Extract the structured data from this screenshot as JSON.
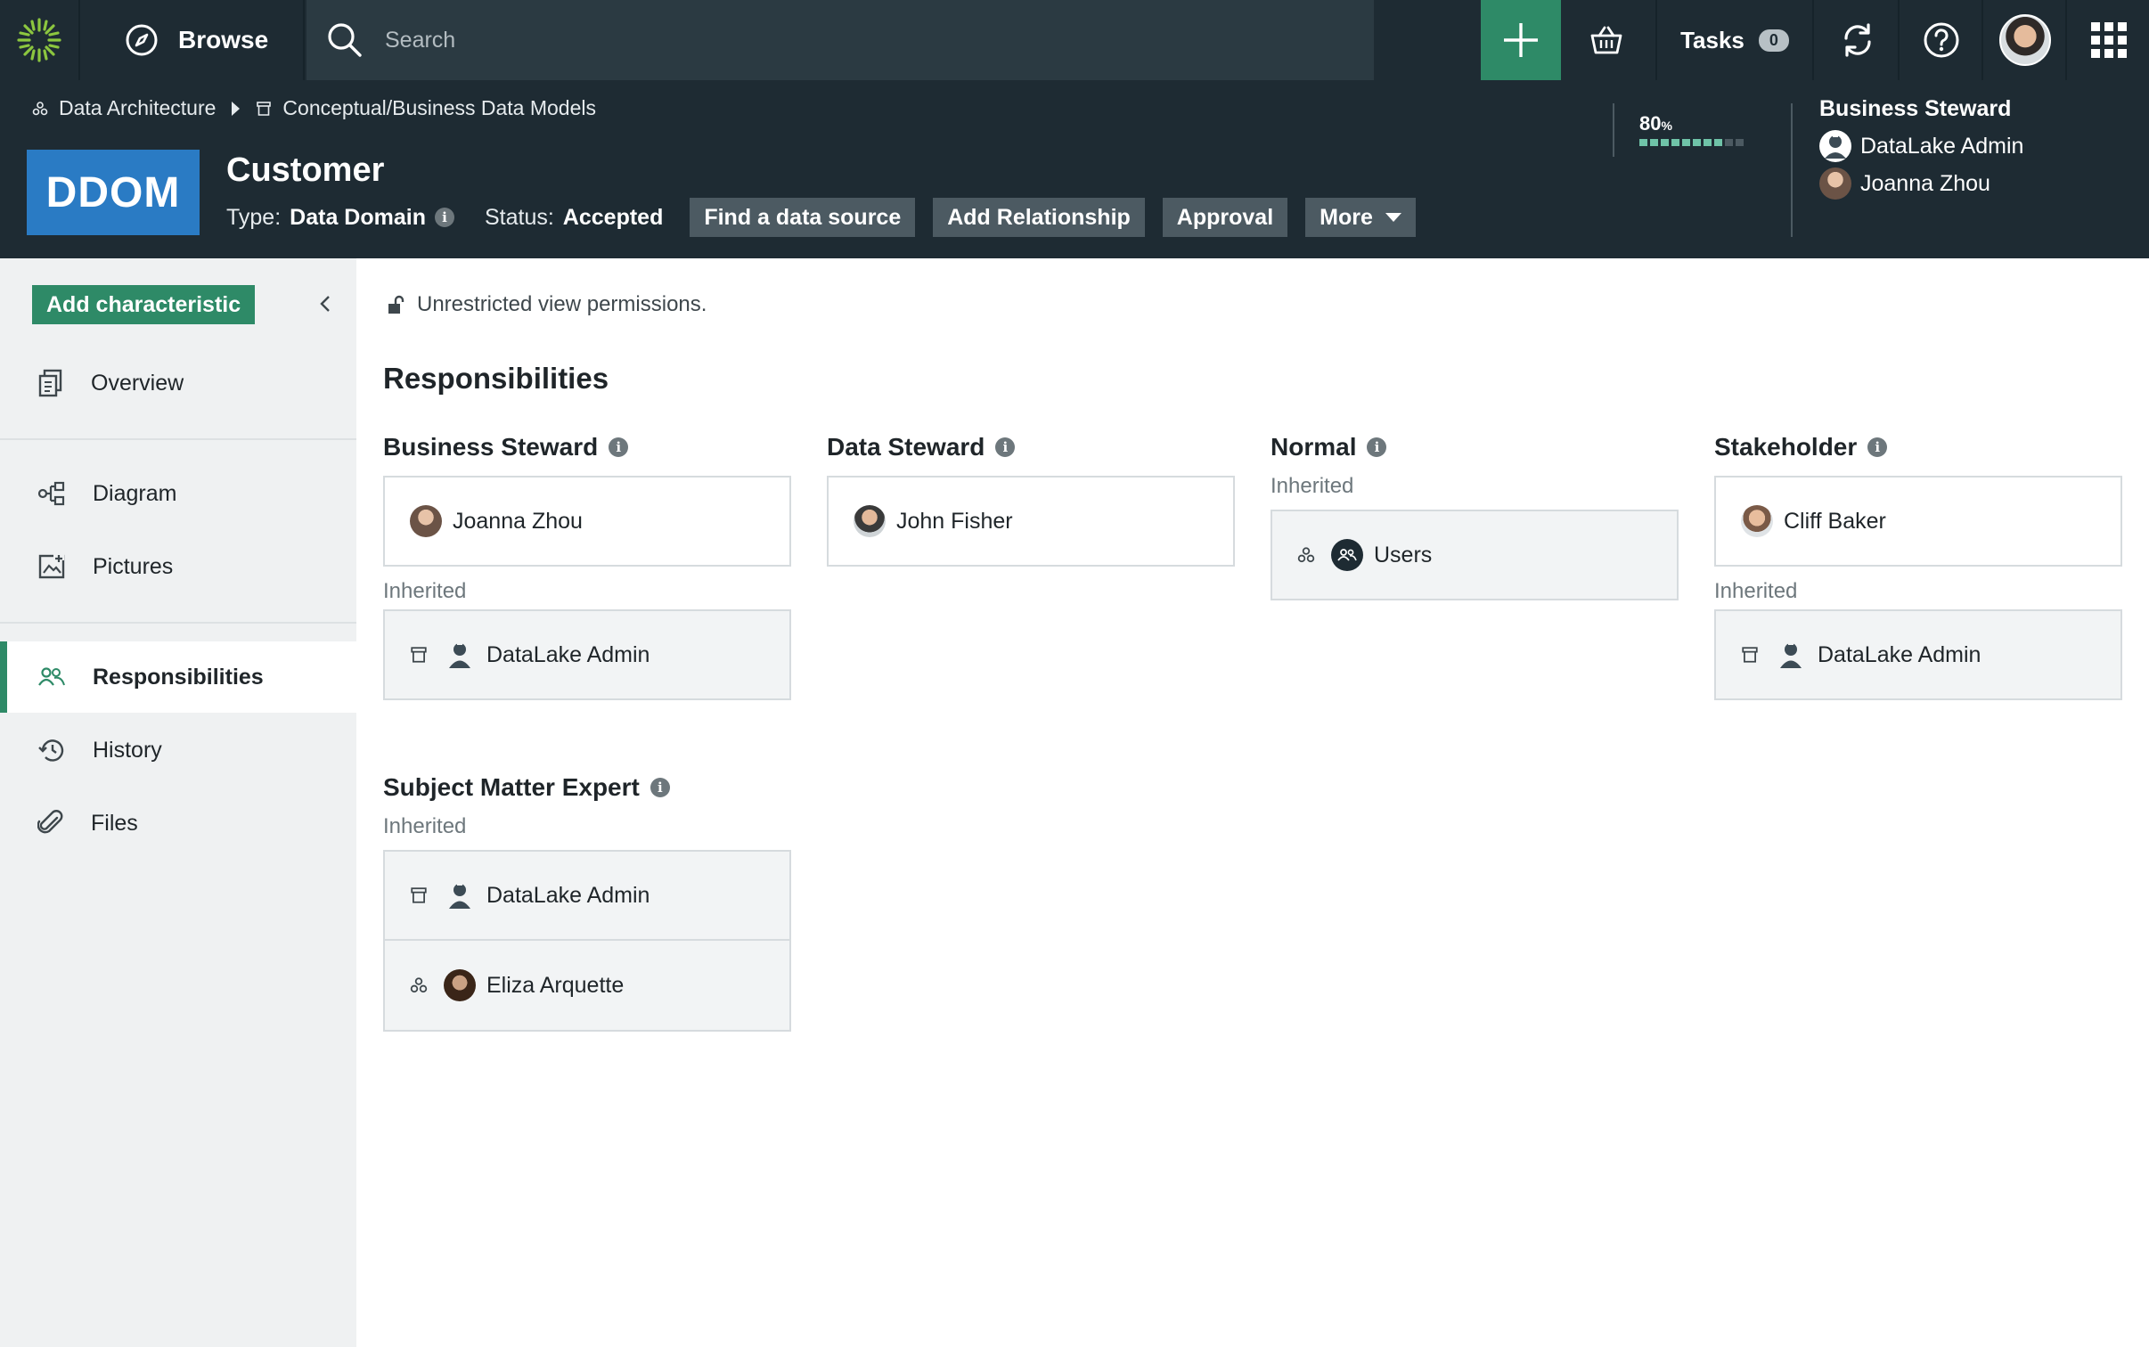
{
  "topbar": {
    "browse_label": "Browse",
    "search_placeholder": "Search",
    "tasks_label": "Tasks",
    "tasks_count": "0",
    "icons": [
      "logo-icon",
      "compass-icon",
      "search-icon",
      "plus-icon",
      "basket-icon",
      "sync-icon",
      "help-icon",
      "avatar",
      "apps-grid-icon"
    ],
    "accent_color": "#2e8a67"
  },
  "header": {
    "breadcrumb": [
      {
        "label": "Data Architecture",
        "icon": "community-icon"
      },
      {
        "label": "Conceptual/Business Data Models",
        "icon": "domain-icon"
      }
    ],
    "asset_badge": "DDOM",
    "asset_badge_color": "#2a7bc4",
    "title": "Customer",
    "type_label": "Type:",
    "type_value": "Data Domain",
    "status_label": "Status:",
    "status_value": "Accepted",
    "actions": [
      "Find a data source",
      "Add Relationship",
      "Approval",
      "More"
    ],
    "score_value": "80",
    "score_unit": "%",
    "score_fraction": 0.8,
    "steward_label": "Business Steward",
    "stewards": [
      "DataLake Admin",
      "Joanna Zhou"
    ]
  },
  "sidebar": {
    "add_button": "Add characteristic",
    "items": [
      {
        "label": "Overview",
        "icon": "overview-icon"
      },
      {
        "label": "Diagram",
        "icon": "diagram-icon"
      },
      {
        "label": "Pictures",
        "icon": "pictures-icon"
      },
      {
        "label": "Responsibilities",
        "icon": "users-icon",
        "active": true
      },
      {
        "label": "History",
        "icon": "history-icon"
      },
      {
        "label": "Files",
        "icon": "paperclip-icon"
      }
    ]
  },
  "main": {
    "permission_text": "Unrestricted view permissions.",
    "section_title": "Responsibilities",
    "inherited_label": "Inherited",
    "roles": {
      "business_steward": {
        "title": "Business Steward",
        "direct": [
          "Joanna Zhou"
        ],
        "inherited": [
          "DataLake Admin"
        ]
      },
      "data_steward": {
        "title": "Data Steward",
        "direct": [
          "John Fisher"
        ]
      },
      "normal": {
        "title": "Normal",
        "inherited": [
          "Users"
        ]
      },
      "stakeholder": {
        "title": "Stakeholder",
        "direct": [
          "Cliff Baker"
        ],
        "inherited": [
          "DataLake Admin"
        ]
      },
      "subject_matter_expert": {
        "title": "Subject Matter Expert",
        "inherited": [
          "DataLake Admin",
          "Eliza Arquette"
        ]
      }
    }
  }
}
